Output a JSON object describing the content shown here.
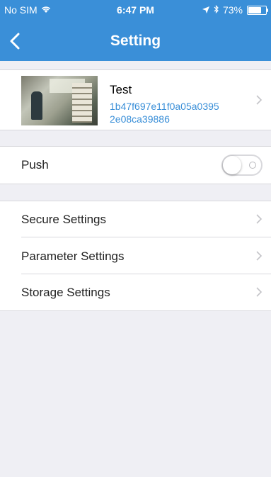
{
  "status_bar": {
    "carrier": "No SIM",
    "time": "6:47 PM",
    "battery": "73%"
  },
  "nav": {
    "title": "Setting"
  },
  "device": {
    "name": "Test",
    "id_line1": "1b47f697e11f0a05a0395",
    "id_line2": "2e08ca39886"
  },
  "push": {
    "label": "Push",
    "enabled": false
  },
  "settings": [
    {
      "label": "Secure Settings"
    },
    {
      "label": "Parameter Settings"
    },
    {
      "label": "Storage Settings"
    }
  ],
  "colors": {
    "accent": "#3a8fd8",
    "background": "#efeff4"
  }
}
